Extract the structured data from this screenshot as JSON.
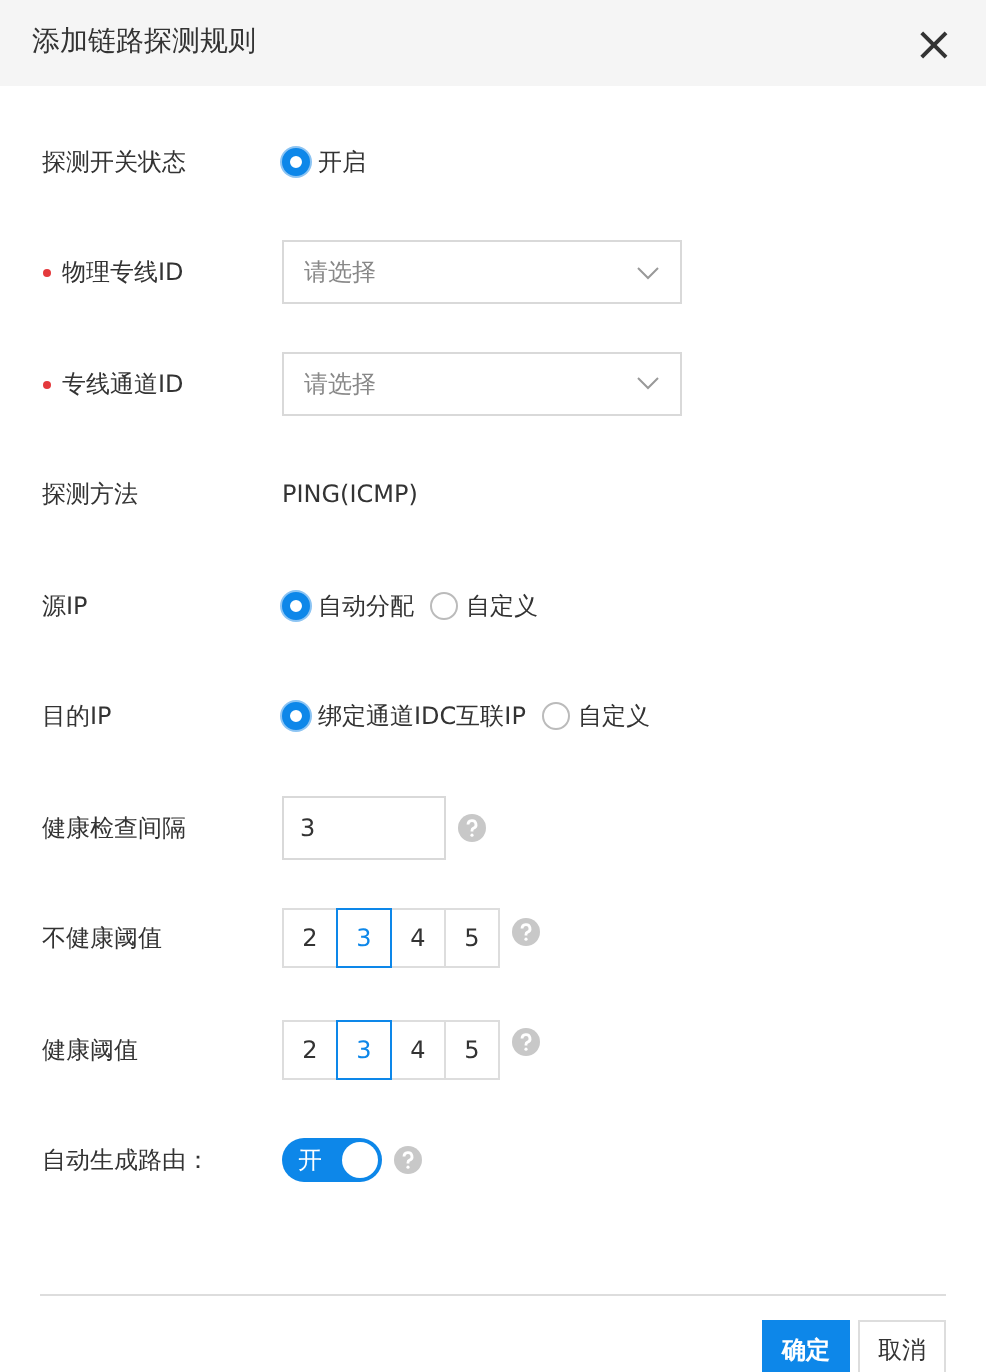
{
  "dialog": {
    "title": "添加链路探测规则",
    "close": "×"
  },
  "fields": [
    {
      "kind": "radio",
      "label": "探测开关状态",
      "options": [
        {
          "label": "开启",
          "selected": true
        }
      ]
    },
    {
      "kind": "select",
      "label": "物理专线ID",
      "required": true,
      "placeholder": "请选择"
    },
    {
      "kind": "select",
      "label": "专线通道ID",
      "required": true,
      "placeholder": "请选择"
    },
    {
      "kind": "text",
      "label": "探测方法",
      "value": "PING(ICMP)"
    },
    {
      "kind": "radio",
      "label": "源IP",
      "options": [
        {
          "label": "自动分配",
          "selected": true
        },
        {
          "label": "自定义",
          "selected": false
        }
      ]
    },
    {
      "kind": "radio",
      "label": "目的IP",
      "options": [
        {
          "label": "绑定通道IDC互联IP",
          "selected": true
        },
        {
          "label": "自定义",
          "selected": false
        }
      ]
    },
    {
      "kind": "input",
      "label": "健康检查间隔",
      "value": "3",
      "help": true
    },
    {
      "kind": "segmented",
      "label": "不健康阈值",
      "help": true,
      "options": [
        {
          "label": "2",
          "selected": false
        },
        {
          "label": "3",
          "selected": true
        },
        {
          "label": "4",
          "selected": false
        },
        {
          "label": "5",
          "selected": false
        }
      ]
    },
    {
      "kind": "segmented",
      "label": "健康阈值",
      "help": true,
      "options": [
        {
          "label": "2",
          "selected": false
        },
        {
          "label": "3",
          "selected": true
        },
        {
          "label": "4",
          "selected": false
        },
        {
          "label": "5",
          "selected": false
        }
      ]
    },
    {
      "kind": "switch",
      "label": "自动生成路由：",
      "help": true,
      "on": true,
      "text": "开"
    }
  ],
  "buttons": [
    {
      "label": "确定",
      "kind": "primary"
    },
    {
      "label": "取消",
      "kind": "secondary"
    }
  ]
}
